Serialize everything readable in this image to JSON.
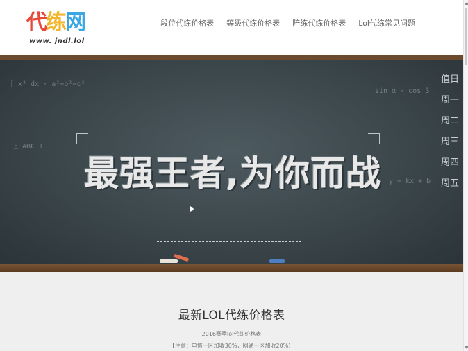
{
  "header": {
    "logo": {
      "text_part1": "代",
      "text_part2": "练",
      "text_part3": "网",
      "url": "www. jndl.lol"
    },
    "nav": [
      {
        "label": "段位代练价格表"
      },
      {
        "label": "等级代练价格表"
      },
      {
        "label": "陪练代练价格表"
      },
      {
        "label": "Lol代练常见问题"
      }
    ]
  },
  "banner": {
    "slogan": "最强王者,为你而战",
    "side_text": [
      "值日",
      "周一",
      "周二",
      "周三",
      "周四",
      "周五"
    ],
    "colors": {
      "chalkboard": "#3b464b",
      "frame": "#6b4a2e"
    }
  },
  "content": {
    "title": "最新LOL代练价格表",
    "subtitle": "2016赛季lol代练价格表",
    "note": "【注意：电信一区加收30%，网通一区加收20%】"
  }
}
